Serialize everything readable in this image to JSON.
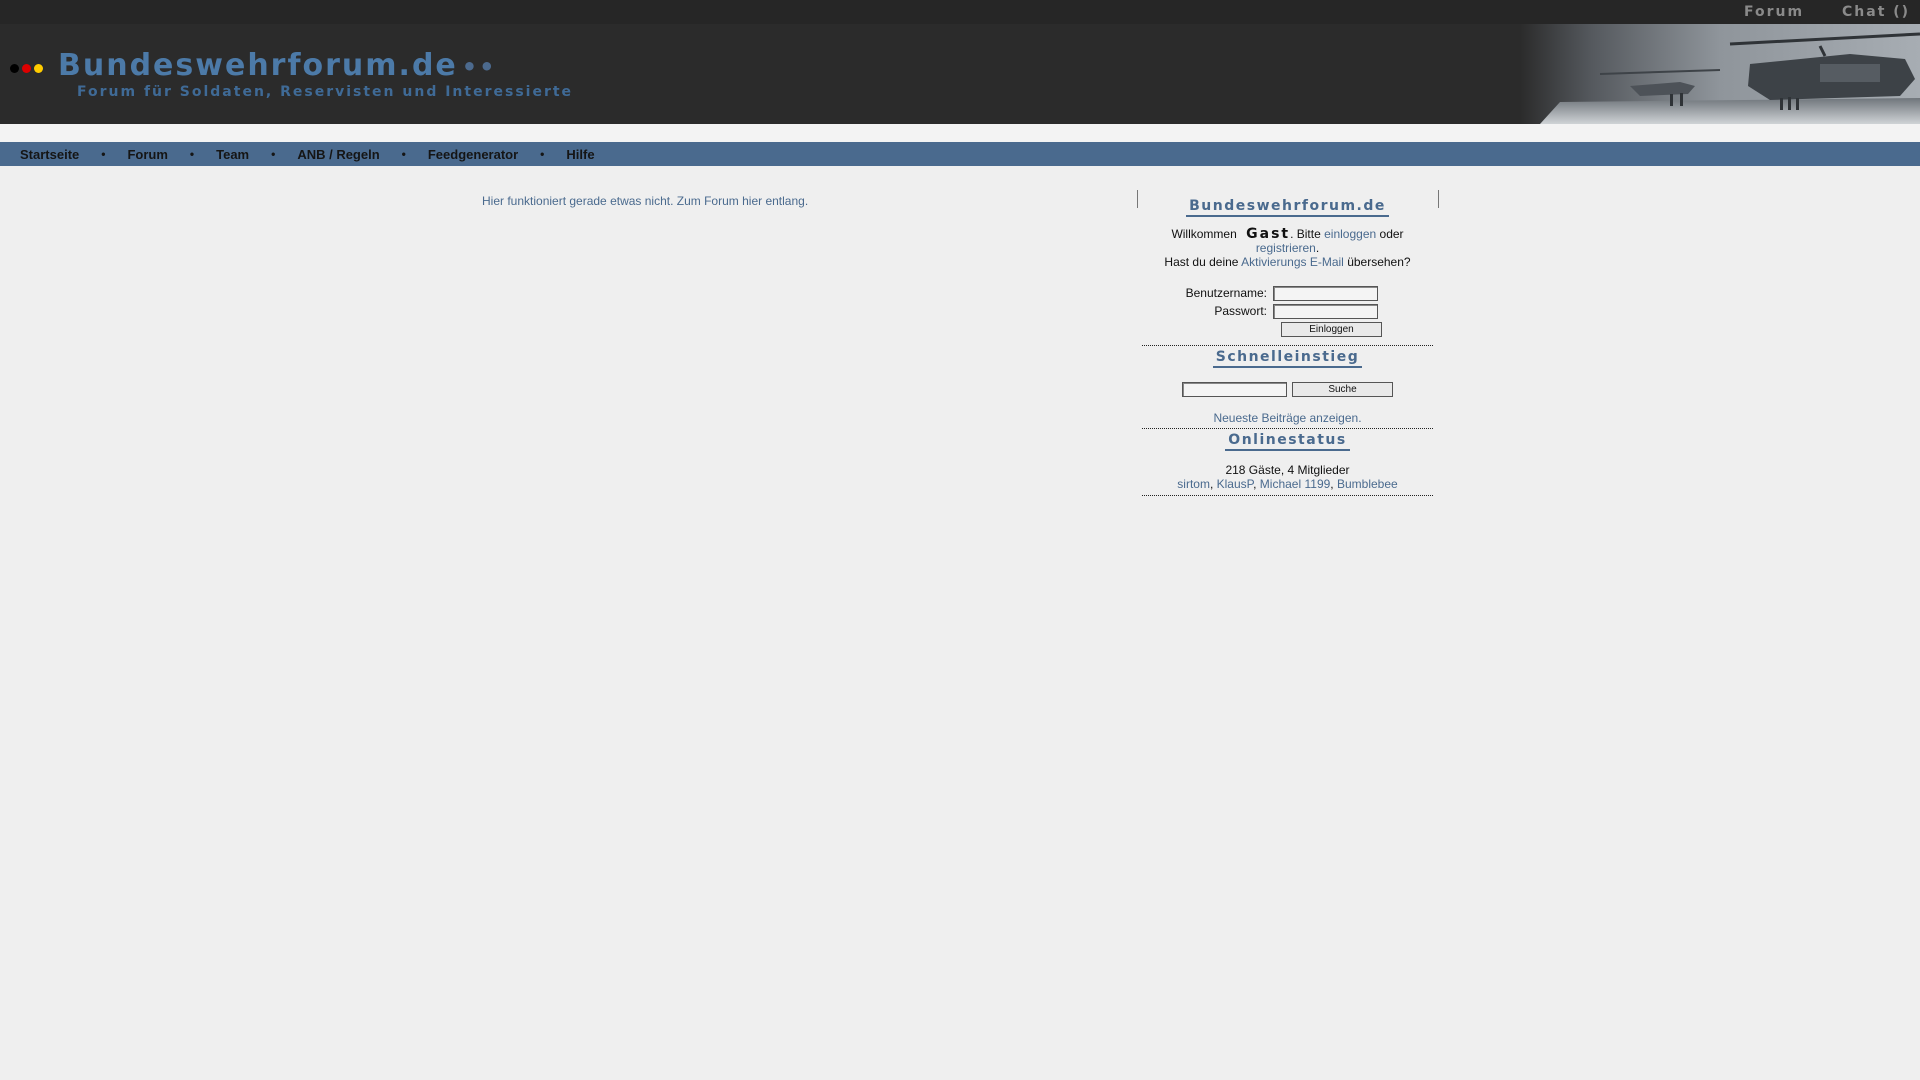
{
  "topbar": {
    "forum_label": "Forum",
    "chat_label": "Chat ()"
  },
  "header": {
    "title": "Bundeswehrforum.de",
    "title_dots": "••",
    "subtitle": "Forum für Soldaten, Reservisten und Interessierte",
    "flag_colors": [
      "#000000",
      "#dd0000",
      "#ffcc00"
    ]
  },
  "nav": {
    "items": [
      {
        "label": "Startseite"
      },
      {
        "label": "Forum"
      },
      {
        "label": "Team"
      },
      {
        "label": "ANB / Regeln"
      },
      {
        "label": "Feedgenerator"
      },
      {
        "label": "Hilfe"
      }
    ],
    "separator": "•"
  },
  "main": {
    "notice": "Hier funktioniert gerade etwas nicht. Zum Forum hier entlang."
  },
  "sidebar": {
    "login_section": {
      "title": "Bundeswehrforum.de",
      "welcome_prefix": "Willkommen",
      "guest_name": "Gast",
      "please_text": ". Bitte",
      "login_link": "einloggen",
      "or_text": "oder",
      "register_link": "registrieren",
      "period": ".",
      "activation_prefix": "Hast du deine",
      "activation_link": "Aktivierungs E-Mail",
      "activation_suffix": "übersehen?",
      "username_label": "Benutzername:",
      "password_label": "Passwort:",
      "login_button": "Einloggen",
      "username_value": "",
      "password_value": ""
    },
    "quick_section": {
      "title": "Schnelleinstieg",
      "search_value": "",
      "search_button": "Suche",
      "newest_link": "Neueste Beiträge anzeigen."
    },
    "online_section": {
      "title": "Onlinestatus",
      "summary": "218 Gäste, 4 Mitglieder",
      "members": [
        "sirtom",
        "KlausP",
        "Michael 1199",
        "Bumblebee"
      ],
      "separator": ", "
    }
  },
  "colors": {
    "accent": "#4a6a8e",
    "header_bg": "#2b2b2b",
    "topbar_bg": "#262626",
    "page_bg": "#efefef"
  }
}
